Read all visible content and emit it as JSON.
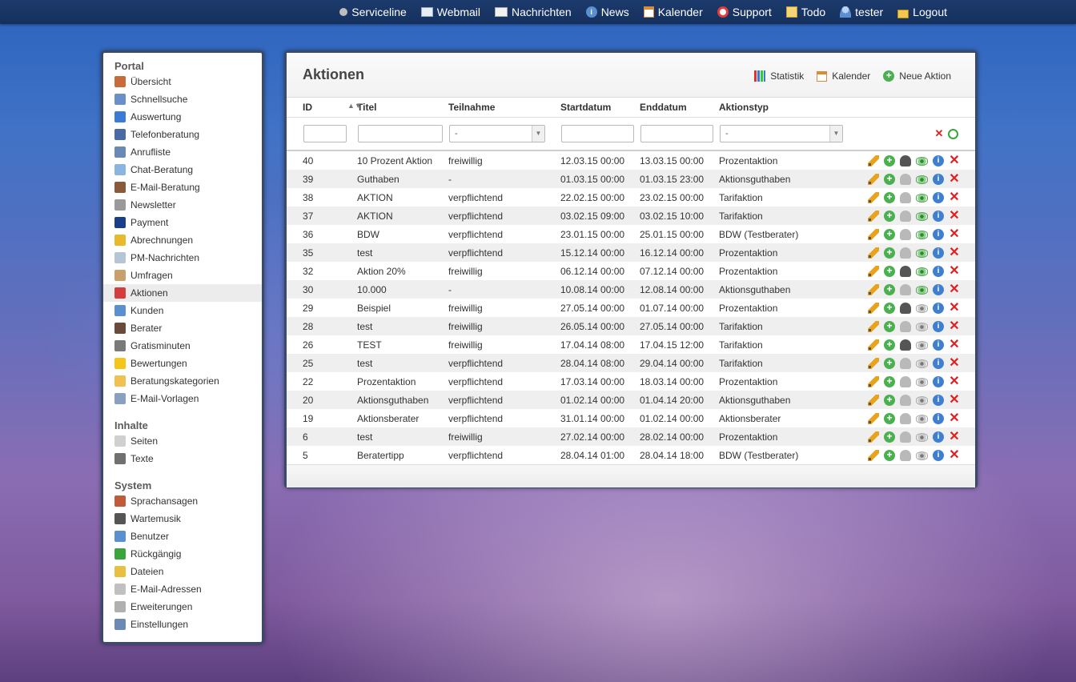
{
  "topnav": [
    {
      "label": "Serviceline",
      "icon": "status-dot-icon"
    },
    {
      "label": "Webmail",
      "icon": "webmail-icon"
    },
    {
      "label": "Nachrichten",
      "icon": "envelope-icon"
    },
    {
      "label": "News",
      "icon": "info-icon"
    },
    {
      "label": "Kalender",
      "icon": "calendar-icon"
    },
    {
      "label": "Support",
      "icon": "lifebuoy-icon"
    },
    {
      "label": "Todo",
      "icon": "note-icon"
    },
    {
      "label": "tester",
      "icon": "user-icon"
    },
    {
      "label": "Logout",
      "icon": "lock-icon"
    }
  ],
  "sidebar": {
    "sections": [
      {
        "title": "Portal",
        "items": [
          {
            "label": "Übersicht",
            "color": "#c96a3a"
          },
          {
            "label": "Schnellsuche",
            "color": "#6a8fc9"
          },
          {
            "label": "Auswertung",
            "color": "#3a7bd5"
          },
          {
            "label": "Telefonberatung",
            "color": "#4a6aa5"
          },
          {
            "label": "Anrufliste",
            "color": "#6a8ab5"
          },
          {
            "label": "Chat-Beratung",
            "color": "#8ab5e0"
          },
          {
            "label": "E-Mail-Beratung",
            "color": "#8a5a3a"
          },
          {
            "label": "Newsletter",
            "color": "#9a9a9a"
          },
          {
            "label": "Payment",
            "color": "#1a3f8a"
          },
          {
            "label": "Abrechnungen",
            "color": "#e8b92a"
          },
          {
            "label": "PM-Nachrichten",
            "color": "#b5c5d5"
          },
          {
            "label": "Umfragen",
            "color": "#c9a06a"
          },
          {
            "label": "Aktionen",
            "color": "#d33d3d",
            "active": true
          },
          {
            "label": "Kunden",
            "color": "#5a8fd0"
          },
          {
            "label": "Berater",
            "color": "#6a4a3a"
          },
          {
            "label": "Gratisminuten",
            "color": "#7a7a7a"
          },
          {
            "label": "Bewertungen",
            "color": "#f5c518"
          },
          {
            "label": "Beratungskategorien",
            "color": "#f0c050"
          },
          {
            "label": "E-Mail-Vorlagen",
            "color": "#8aa0c0"
          }
        ]
      },
      {
        "title": "Inhalte",
        "items": [
          {
            "label": "Seiten",
            "color": "#d0d0d0"
          },
          {
            "label": "Texte",
            "color": "#707070"
          }
        ]
      },
      {
        "title": "System",
        "items": [
          {
            "label": "Sprachansagen",
            "color": "#c05a3a"
          },
          {
            "label": "Wartemusik",
            "color": "#555555"
          },
          {
            "label": "Benutzer",
            "color": "#5a8fd0"
          },
          {
            "label": "Rückgängig",
            "color": "#3aa53a"
          },
          {
            "label": "Dateien",
            "color": "#e8c040"
          },
          {
            "label": "E-Mail-Adressen",
            "color": "#c0c0c0"
          },
          {
            "label": "Erweiterungen",
            "color": "#b0b0b0"
          },
          {
            "label": "Einstellungen",
            "color": "#6a8ab5"
          }
        ]
      }
    ]
  },
  "main": {
    "title": "Aktionen",
    "actions": [
      {
        "label": "Statistik",
        "icon": "chart-icon"
      },
      {
        "label": "Kalender",
        "icon": "calendar-icon"
      },
      {
        "label": "Neue Aktion",
        "icon": "add-icon"
      }
    ],
    "columns": [
      "ID",
      "Titel",
      "Teilnahme",
      "Startdatum",
      "Enddatum",
      "Aktionstyp"
    ],
    "filters": {
      "teilnahme_selected": "-",
      "aktionstyp_selected": "-"
    },
    "rows": [
      {
        "id": "40",
        "titel": "10 Prozent Aktion",
        "teilnahme": "freiwillig",
        "start": "12.03.15 00:00",
        "end": "13.03.15 00:00",
        "typ": "Prozentaktion",
        "person_active": true,
        "eye_active": true
      },
      {
        "id": "39",
        "titel": "Guthaben",
        "teilnahme": "-",
        "start": "01.03.15 00:00",
        "end": "01.03.15 23:00",
        "typ": "Aktionsguthaben",
        "person_active": false,
        "eye_active": true
      },
      {
        "id": "38",
        "titel": "AKTION",
        "teilnahme": "verpflichtend",
        "start": "22.02.15 00:00",
        "end": "23.02.15 00:00",
        "typ": "Tarifaktion",
        "person_active": false,
        "eye_active": true
      },
      {
        "id": "37",
        "titel": "AKTION",
        "teilnahme": "verpflichtend",
        "start": "03.02.15 09:00",
        "end": "03.02.15 10:00",
        "typ": "Tarifaktion",
        "person_active": false,
        "eye_active": true
      },
      {
        "id": "36",
        "titel": "BDW",
        "teilnahme": "verpflichtend",
        "start": "23.01.15 00:00",
        "end": "25.01.15 00:00",
        "typ": "BDW (Testberater)",
        "person_active": false,
        "eye_active": true
      },
      {
        "id": "35",
        "titel": "test",
        "teilnahme": "verpflichtend",
        "start": "15.12.14 00:00",
        "end": "16.12.14 00:00",
        "typ": "Prozentaktion",
        "person_active": false,
        "eye_active": true
      },
      {
        "id": "32",
        "titel": "Aktion 20%",
        "teilnahme": "freiwillig",
        "start": "06.12.14 00:00",
        "end": "07.12.14 00:00",
        "typ": "Prozentaktion",
        "person_active": true,
        "eye_active": true
      },
      {
        "id": "30",
        "titel": "10.000",
        "teilnahme": "-",
        "start": "10.08.14 00:00",
        "end": "12.08.14 00:00",
        "typ": "Aktionsguthaben",
        "person_active": false,
        "eye_active": true
      },
      {
        "id": "29",
        "titel": "Beispiel",
        "teilnahme": "freiwillig",
        "start": "27.05.14 00:00",
        "end": "01.07.14 00:00",
        "typ": "Prozentaktion",
        "person_active": true,
        "eye_active": false
      },
      {
        "id": "28",
        "titel": "test",
        "teilnahme": "freiwillig",
        "start": "26.05.14 00:00",
        "end": "27.05.14 00:00",
        "typ": "Tarifaktion",
        "person_active": false,
        "eye_active": false
      },
      {
        "id": "26",
        "titel": "TEST",
        "teilnahme": "freiwillig",
        "start": "17.04.14 08:00",
        "end": "17.04.15 12:00",
        "typ": "Tarifaktion",
        "person_active": true,
        "eye_active": false
      },
      {
        "id": "25",
        "titel": "test",
        "teilnahme": "verpflichtend",
        "start": "28.04.14 08:00",
        "end": "29.04.14 00:00",
        "typ": "Tarifaktion",
        "person_active": false,
        "eye_active": false
      },
      {
        "id": "22",
        "titel": "Prozentaktion",
        "teilnahme": "verpflichtend",
        "start": "17.03.14 00:00",
        "end": "18.03.14 00:00",
        "typ": "Prozentaktion",
        "person_active": false,
        "eye_active": false
      },
      {
        "id": "20",
        "titel": "Aktionsguthaben",
        "teilnahme": "verpflichtend",
        "start": "01.02.14 00:00",
        "end": "01.04.14 20:00",
        "typ": "Aktionsguthaben",
        "person_active": false,
        "eye_active": false
      },
      {
        "id": "19",
        "titel": "Aktionsberater",
        "teilnahme": "verpflichtend",
        "start": "31.01.14 00:00",
        "end": "01.02.14 00:00",
        "typ": "Aktionsberater",
        "person_active": false,
        "eye_active": false
      },
      {
        "id": "6",
        "titel": "test",
        "teilnahme": "freiwillig",
        "start": "27.02.14 00:00",
        "end": "28.02.14 00:00",
        "typ": "Prozentaktion",
        "person_active": false,
        "eye_active": false
      },
      {
        "id": "5",
        "titel": "Beratertipp",
        "teilnahme": "verpflichtend",
        "start": "28.04.14 01:00",
        "end": "28.04.14 18:00",
        "typ": "BDW (Testberater)",
        "person_active": false,
        "eye_active": false
      }
    ]
  }
}
